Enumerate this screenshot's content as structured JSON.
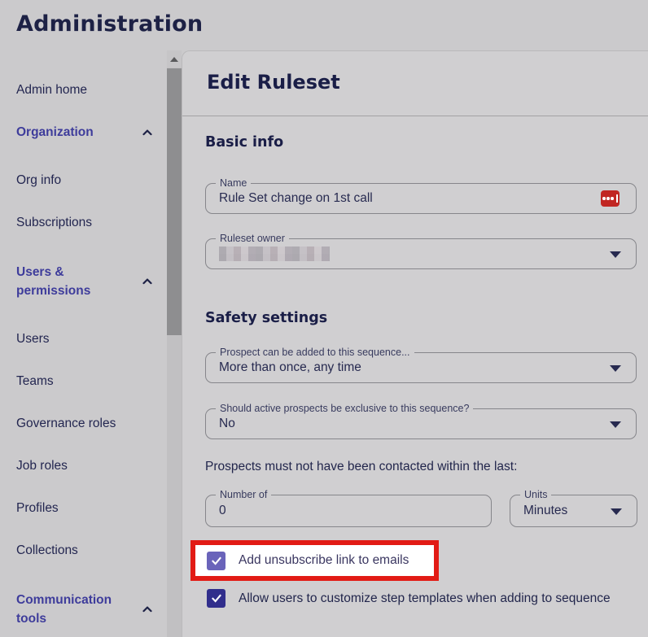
{
  "header": {
    "title": "Administration"
  },
  "sidebar": {
    "items": [
      {
        "label": "Admin home"
      },
      {
        "label": "Organization",
        "type": "section",
        "expanded": true
      },
      {
        "label": "Org info"
      },
      {
        "label": "Subscriptions"
      },
      {
        "label": "Users & permissions",
        "type": "section",
        "expanded": true
      },
      {
        "label": "Users"
      },
      {
        "label": "Teams"
      },
      {
        "label": "Governance roles"
      },
      {
        "label": "Job roles"
      },
      {
        "label": "Profiles"
      },
      {
        "label": "Collections"
      },
      {
        "label": "Communication tools",
        "type": "section",
        "expanded": true
      }
    ]
  },
  "panel": {
    "title": "Edit Ruleset",
    "basic_info": {
      "heading": "Basic info",
      "name_field": {
        "label": "Name",
        "value": "Rule Set change on 1st call"
      },
      "owner_field": {
        "label": "Ruleset owner",
        "value": "",
        "redacted": true
      }
    },
    "safety_settings": {
      "heading": "Safety settings",
      "added_dropdown": {
        "label": "Prospect can be added to this sequence...",
        "value": "More than once, any time"
      },
      "exclusive_dropdown": {
        "label": "Should active prospects be exclusive to this sequence?",
        "value": "No"
      },
      "contacted_label": "Prospects must not have been contacted within the last:",
      "number_field": {
        "label": "Number of",
        "value": "0"
      },
      "units_dropdown": {
        "label": "Units",
        "value": "Minutes"
      },
      "unsubscribe_checkbox": {
        "label": "Add unsubscribe link to emails",
        "checked": true,
        "highlighted": true
      },
      "customize_checkbox": {
        "label": "Allow users to customize step templates when adding to sequence",
        "checked": true
      }
    }
  },
  "icons": {
    "chevron_up": "chevron-up-icon",
    "dropdown_caret": "caret-down-icon",
    "password_manager": "lastpass-icon",
    "checkmark": "check-icon",
    "scroll_up": "scroll-up-arrow-icon"
  },
  "colors": {
    "heading_navy": "#1a1e47",
    "sidebar_purple": "#3e3c9b",
    "checkbox_purple": "#6a64ba",
    "checkbox_indigo": "#312e8c",
    "highlight_red": "#e21b15",
    "lastpass_red": "#c12622",
    "panel_bg": "#d0cfd1",
    "page_bg": "#cbcacc"
  }
}
